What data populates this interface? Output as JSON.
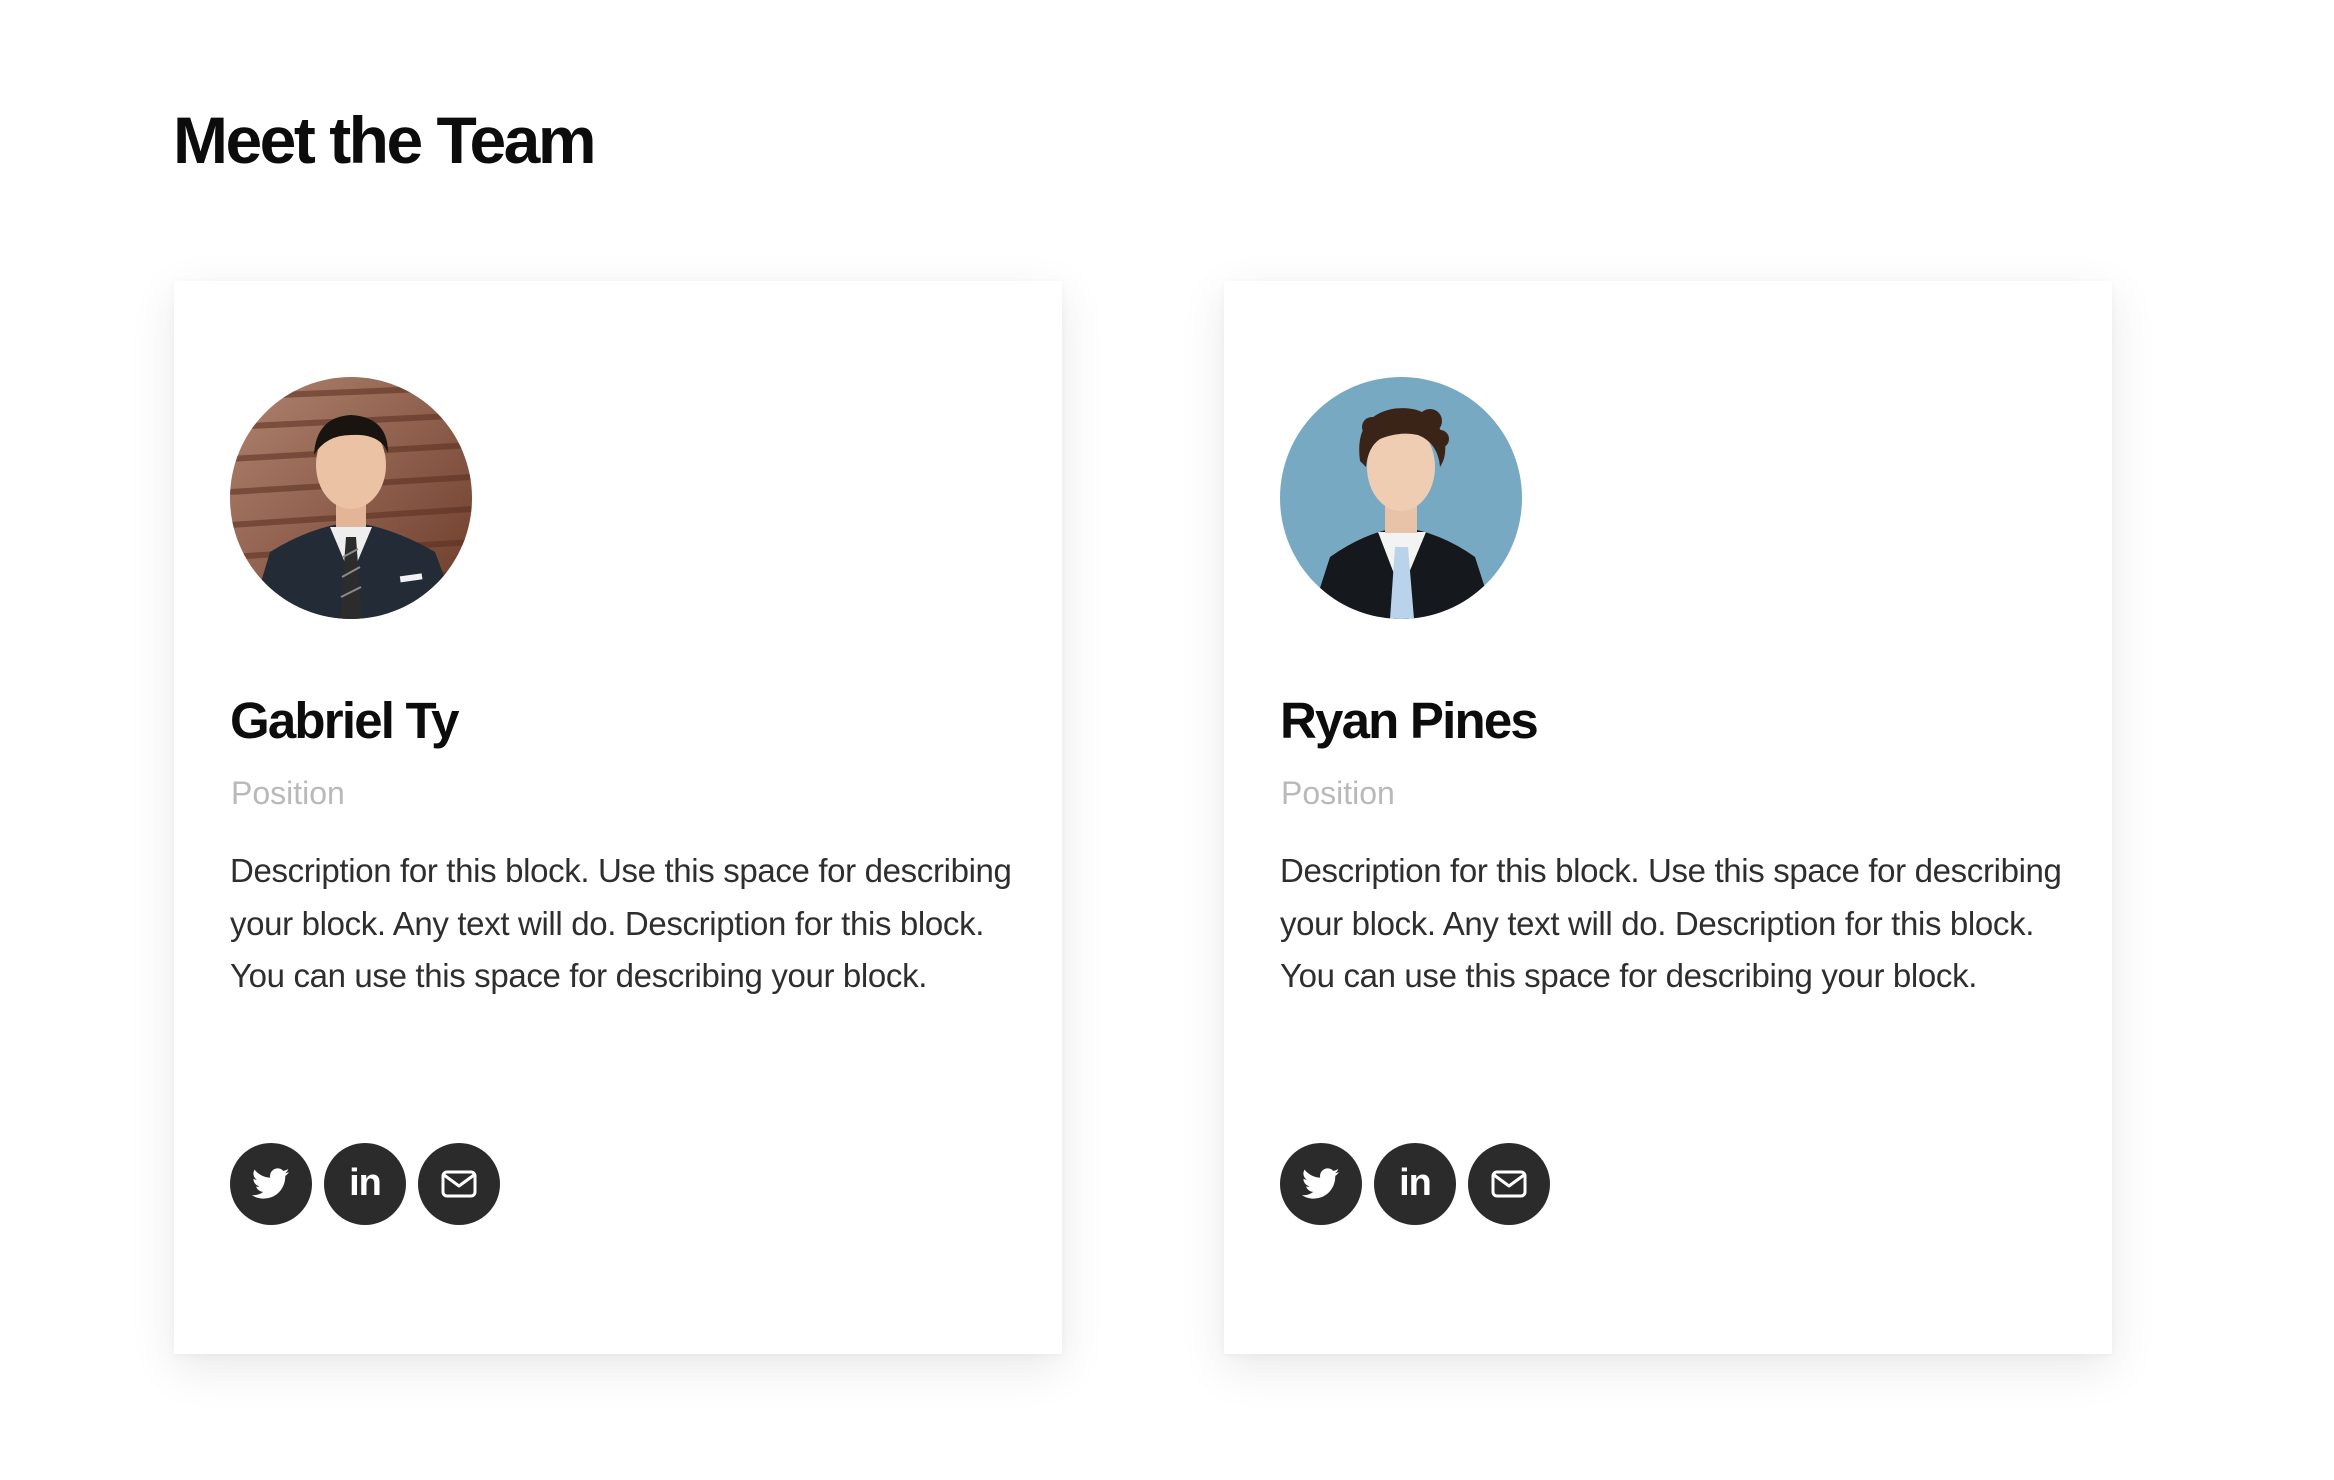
{
  "page": {
    "title": "Meet the Team"
  },
  "team": [
    {
      "name": "Gabriel Ty",
      "position": "Position",
      "description": "Description for this block. Use this space for describing your block. Any text will do. Description for this block. You can use this space for describing your block.",
      "avatar_bg": "#8a5a44",
      "socials": [
        {
          "icon": "twitter-icon",
          "label": "twitter"
        },
        {
          "icon": "linkedin-icon",
          "label": "in"
        },
        {
          "icon": "mail-icon",
          "label": "email"
        }
      ]
    },
    {
      "name": "Ryan Pines",
      "position": "Position",
      "description": "Description for this block. Use this space for describing your block. Any text will do. Description for this block. You can use this space for describing your block.",
      "avatar_bg": "#78a9c2",
      "socials": [
        {
          "icon": "twitter-icon",
          "label": "twitter"
        },
        {
          "icon": "linkedin-icon",
          "label": "in"
        },
        {
          "icon": "mail-icon",
          "label": "email"
        }
      ]
    }
  ],
  "colors": {
    "social_bg": "#2b2b2b",
    "position_text": "#b9b9b9",
    "heading": "#0c0c0c"
  }
}
